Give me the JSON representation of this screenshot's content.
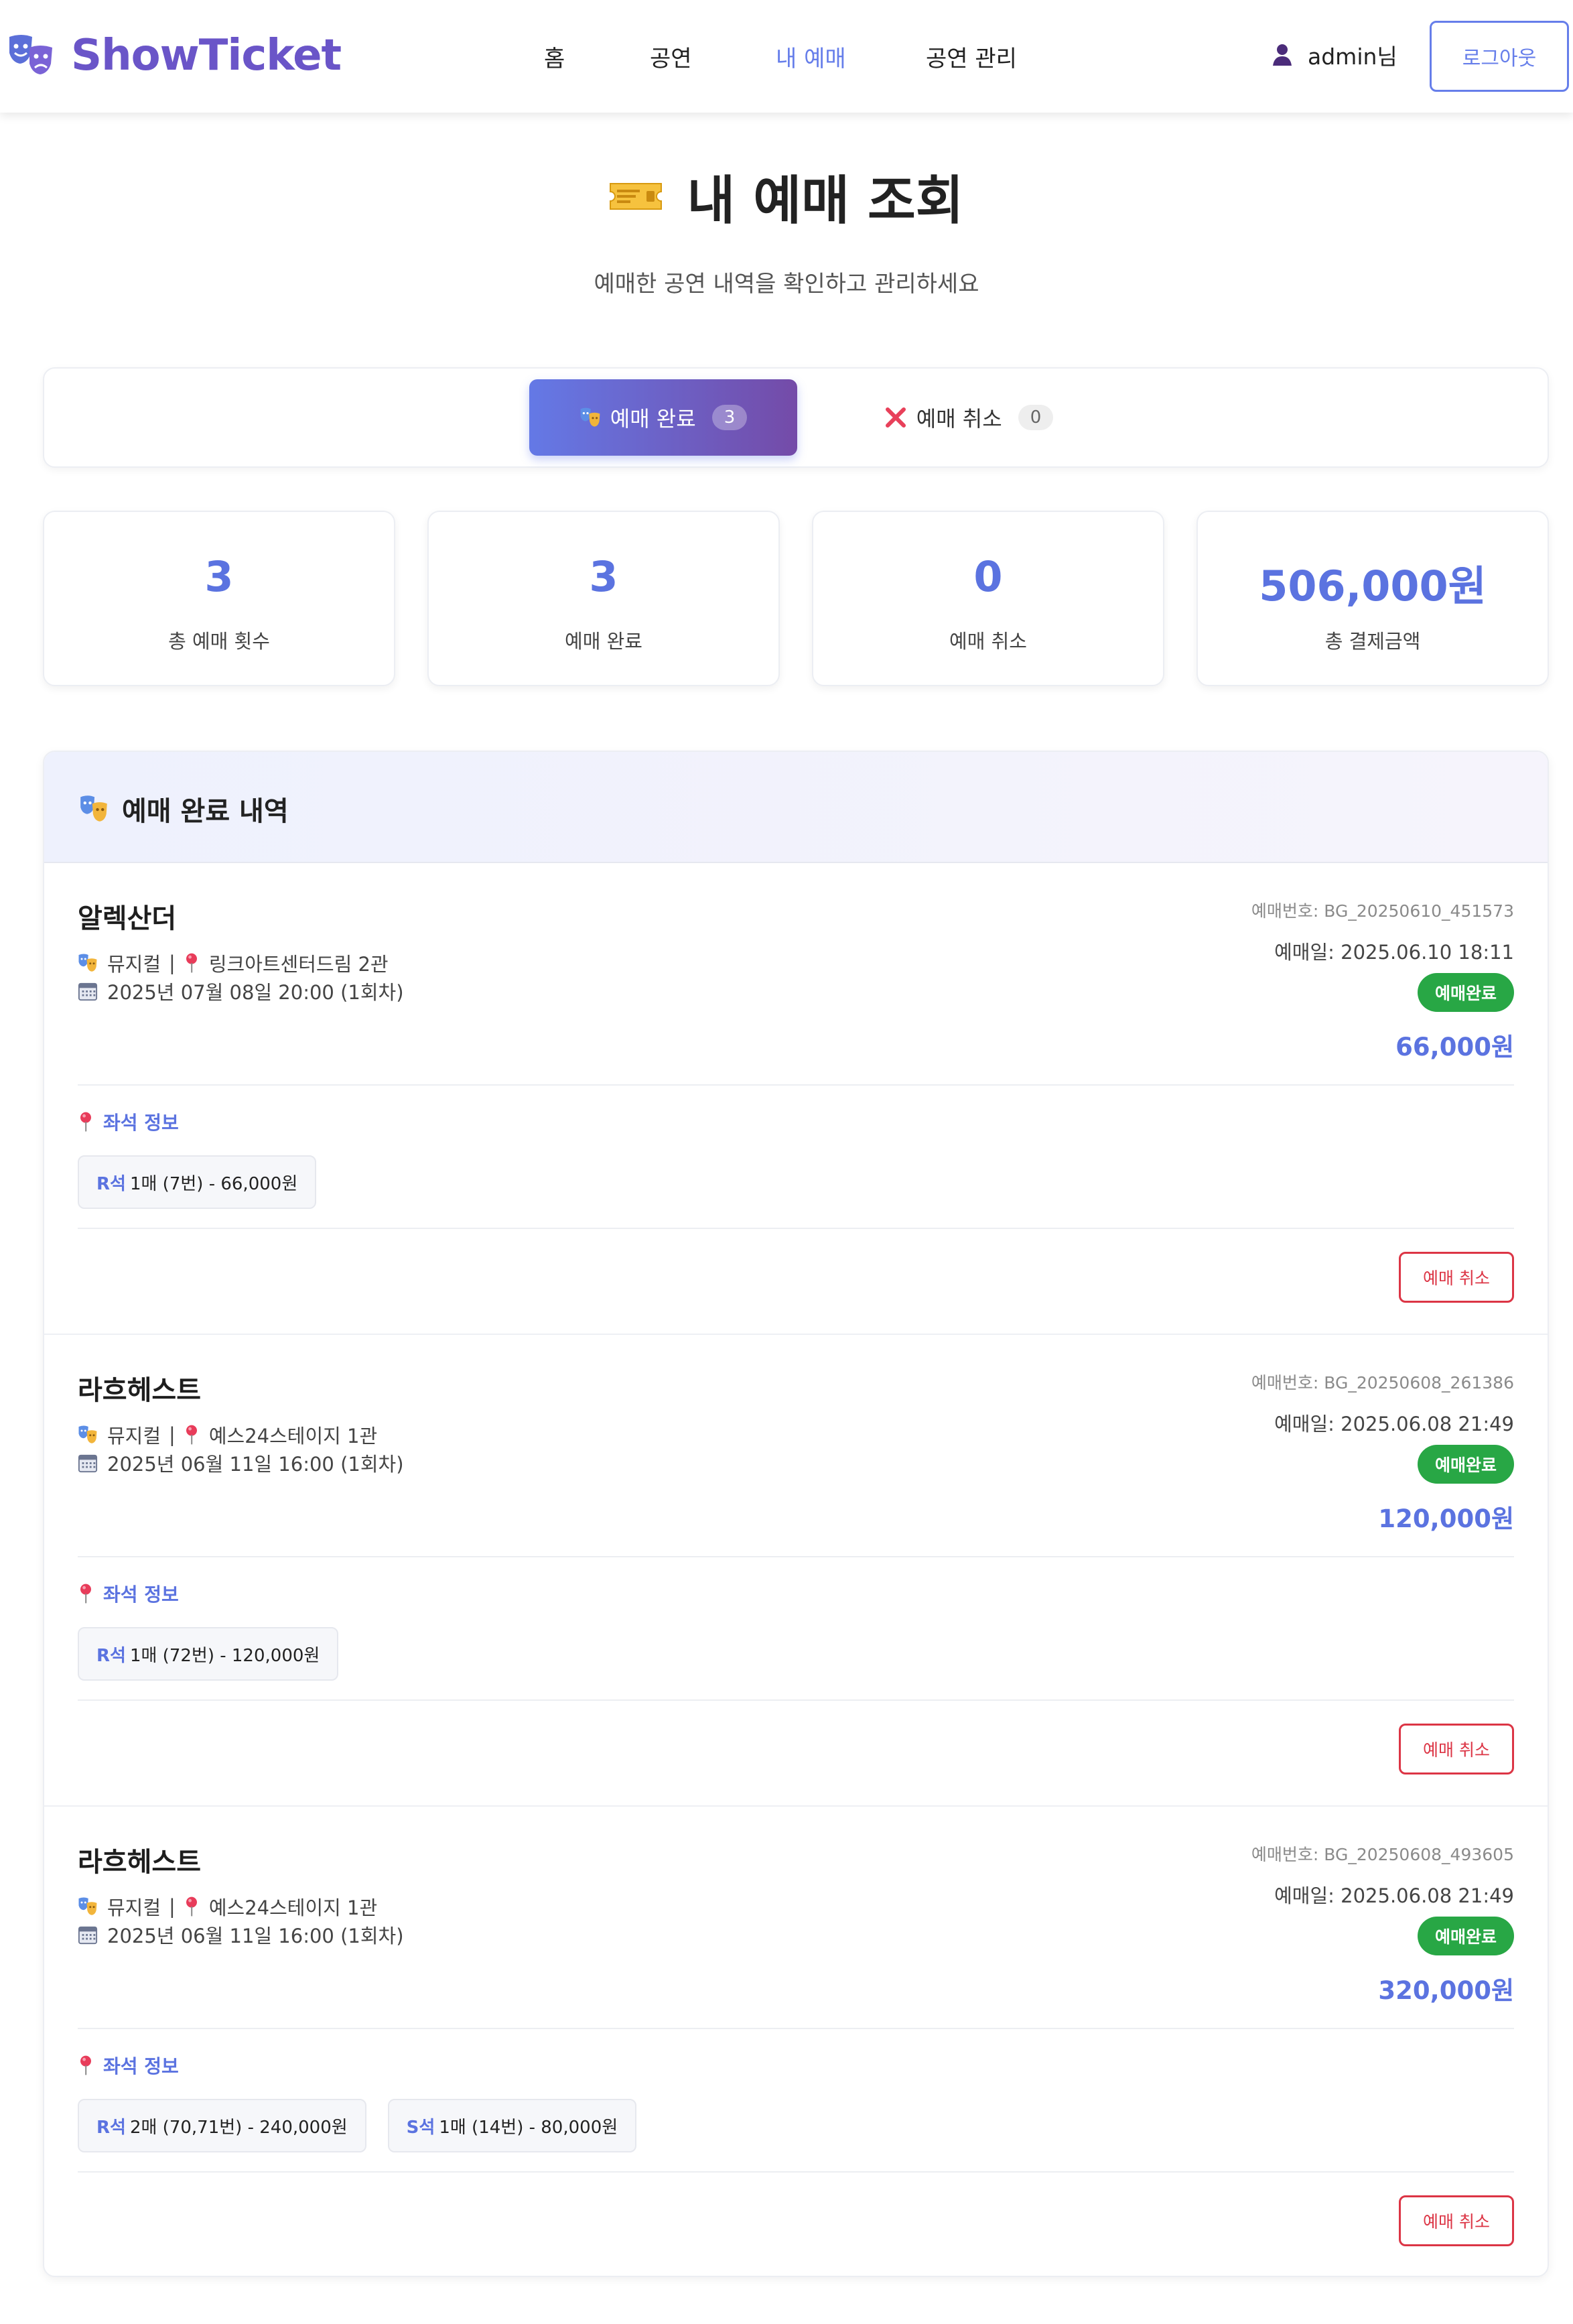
{
  "brand": {
    "name": "ShowTicket"
  },
  "nav": {
    "home": "홈",
    "shows": "공연",
    "my_bookings": "내 예매",
    "manage": "공연 관리"
  },
  "user": {
    "name": "admin님",
    "logout": "로그아웃"
  },
  "page": {
    "title": "내 예매 조회",
    "subtitle": "예매한 공연 내역을 확인하고 관리하세요"
  },
  "tabs": {
    "completed": {
      "label": "예매 완료",
      "count": "3"
    },
    "cancelled": {
      "label": "예매 취소",
      "count": "0"
    }
  },
  "stats": [
    {
      "value": "3",
      "label": "총 예매 횟수"
    },
    {
      "value": "3",
      "label": "예매 완료"
    },
    {
      "value": "0",
      "label": "예매 취소"
    },
    {
      "value": "506,000원",
      "label": "총 결제금액"
    }
  ],
  "list": {
    "title": "예매 완료 내역",
    "bookings": [
      {
        "title": "알렉산더",
        "genre": "뮤지컬",
        "venue": "링크아트센터드림 2관",
        "show_date": "2025년 07월 08일 20:00 (1회차)",
        "booking_no": "예매번호: BG_20250610_451573",
        "booking_date": "예매일: 2025.06.10 18:11",
        "status": "예매완료",
        "price": "66,000원",
        "seat_label": "좌석 정보",
        "seats": [
          {
            "grade": "R석",
            "detail": "1매 (7번) - 66,000원"
          }
        ],
        "cancel": "예매 취소"
      },
      {
        "title": "라흐헤스트",
        "genre": "뮤지컬",
        "venue": "예스24스테이지 1관",
        "show_date": "2025년 06월 11일 16:00 (1회차)",
        "booking_no": "예매번호: BG_20250608_261386",
        "booking_date": "예매일: 2025.06.08 21:49",
        "status": "예매완료",
        "price": "120,000원",
        "seat_label": "좌석 정보",
        "seats": [
          {
            "grade": "R석",
            "detail": "1매 (72번) - 120,000원"
          }
        ],
        "cancel": "예매 취소"
      },
      {
        "title": "라흐헤스트",
        "genre": "뮤지컬",
        "venue": "예스24스테이지 1관",
        "show_date": "2025년 06월 11일 16:00 (1회차)",
        "booking_no": "예매번호: BG_20250608_493605",
        "booking_date": "예매일: 2025.06.08 21:49",
        "status": "예매완료",
        "price": "320,000원",
        "seat_label": "좌석 정보",
        "seats": [
          {
            "grade": "R석",
            "detail": "2매 (70,71번) - 240,000원"
          },
          {
            "grade": "S석",
            "detail": "1매 (14번) - 80,000원"
          }
        ],
        "cancel": "예매 취소"
      }
    ]
  },
  "icons": {
    "logo": "theater-masks-icon",
    "user": "user-icon",
    "ticket": "ticket-icon",
    "genre": "theater-masks-icon",
    "venue": "pin-icon",
    "date": "calendar-icon",
    "cancel_tab": "x-icon"
  },
  "colors": {
    "brand": "#6a55c8",
    "accent": "#667eea",
    "status_green": "#28a745",
    "cancel_red": "#dc3545"
  }
}
